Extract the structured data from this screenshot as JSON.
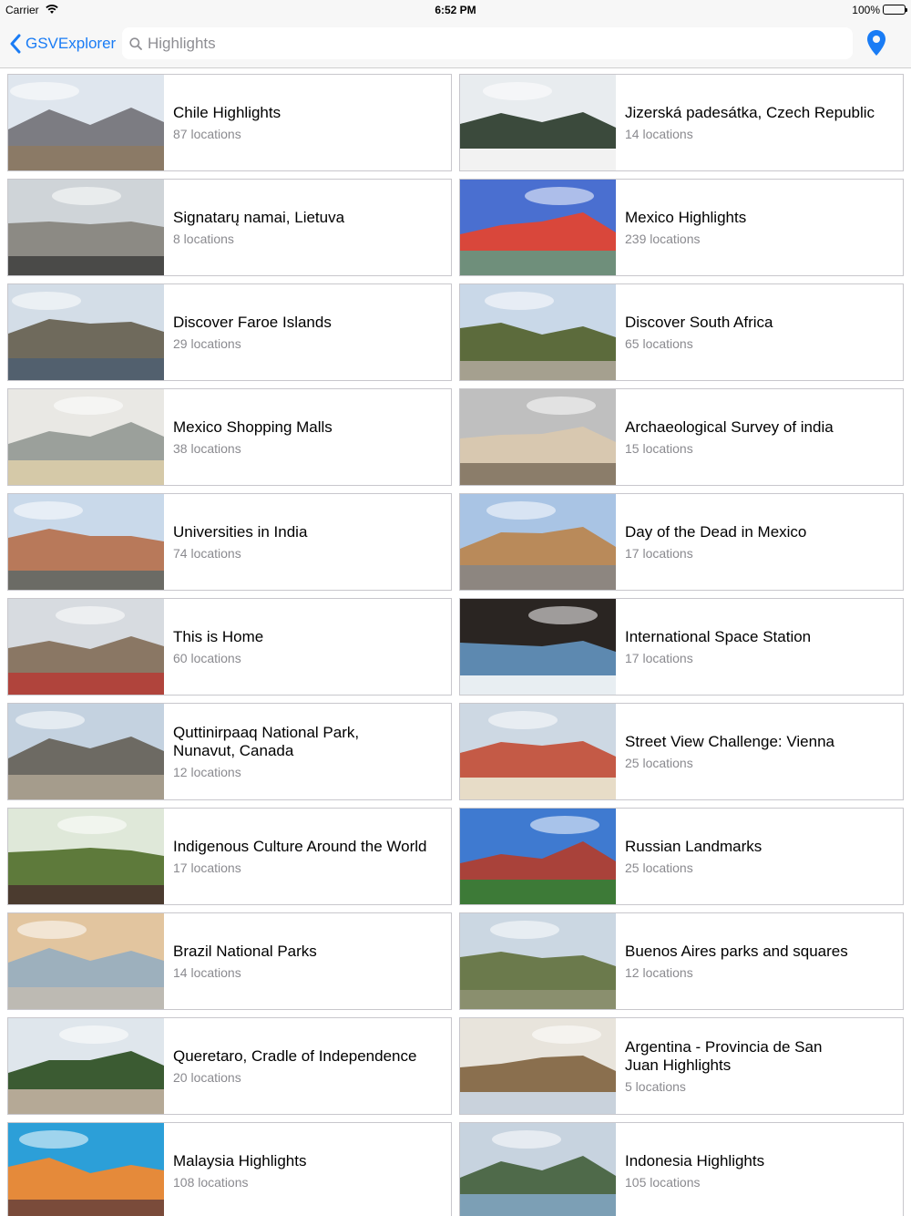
{
  "status_bar": {
    "carrier": "Carrier",
    "time": "6:52 PM",
    "battery": "100%"
  },
  "nav": {
    "back_label": "GSVExplorer",
    "search_placeholder": "Highlights",
    "search_value": "",
    "accent_color": "#1a7cf5"
  },
  "collections": [
    {
      "title": "Chile Highlights",
      "count": "87 locations",
      "thumb": [
        "#dfe6ee",
        "#7c7c82",
        "#8b7a66"
      ]
    },
    {
      "title": "Jizerská padesátka, Czech Republic",
      "count": "14 locations",
      "thumb": [
        "#e8ecef",
        "#3b4a3c",
        "#f2f2f2"
      ]
    },
    {
      "title": "Signatarų namai, Lietuva",
      "count": "8 locations",
      "thumb": [
        "#cfd4d8",
        "#8c8a84",
        "#4a4a48"
      ]
    },
    {
      "title": "Mexico Highlights",
      "count": "239 locations",
      "thumb": [
        "#4a6fd0",
        "#d9473b",
        "#6f8f7b"
      ]
    },
    {
      "title": "Discover Faroe Islands",
      "count": "29 locations",
      "thumb": [
        "#d3dde7",
        "#6f6a5c",
        "#52606e"
      ]
    },
    {
      "title": "Discover South Africa",
      "count": "65 locations",
      "thumb": [
        "#c9d8e8",
        "#5c6b3c",
        "#a5a08f"
      ]
    },
    {
      "title": "Mexico Shopping Malls",
      "count": "38 locations",
      "thumb": [
        "#e9e8e4",
        "#9ba09b",
        "#d5c9a8"
      ]
    },
    {
      "title": "Archaeological Survey of india",
      "count": "15 locations",
      "thumb": [
        "#bfbfbf",
        "#d8c8b0",
        "#8b7d6a"
      ]
    },
    {
      "title": "Universities in India",
      "count": "74 locations",
      "thumb": [
        "#c9d9ea",
        "#b8795a",
        "#6b6b65"
      ]
    },
    {
      "title": "Day of the Dead in Mexico",
      "count": "17 locations",
      "thumb": [
        "#a9c4e4",
        "#b98a5a",
        "#8d8680"
      ]
    },
    {
      "title": "This is Home",
      "count": "60 locations",
      "thumb": [
        "#d7dbe0",
        "#8a7764",
        "#b0443c"
      ]
    },
    {
      "title": "International Space Station",
      "count": "17 locations",
      "thumb": [
        "#2a2522",
        "#5d89b0",
        "#e8eef2"
      ]
    },
    {
      "title": "Quttinirpaaq National Park,\nNunavut, Canada",
      "count": "12 locations",
      "thumb": [
        "#c4d2e0",
        "#6d6a63",
        "#a59c8c"
      ]
    },
    {
      "title": "Street View Challenge: Vienna",
      "count": "25 locations",
      "thumb": [
        "#cdd8e3",
        "#c45a46",
        "#e7dcc7"
      ]
    },
    {
      "title": "Indigenous Culture Around the World",
      "count": "17 locations",
      "thumb": [
        "#dfe8d9",
        "#5e7a3b",
        "#4b3b2f"
      ]
    },
    {
      "title": "Russian Landmarks",
      "count": "25 locations",
      "thumb": [
        "#3f7ad0",
        "#a9423a",
        "#3d7a37"
      ]
    },
    {
      "title": "Brazil National Parks",
      "count": "14 locations",
      "thumb": [
        "#e2c59f",
        "#9db0bd",
        "#bdbab3"
      ]
    },
    {
      "title": "Buenos Aires parks and squares",
      "count": "12 locations",
      "thumb": [
        "#cbd7e2",
        "#6b7a4c",
        "#8a8f6e"
      ]
    },
    {
      "title": "Queretaro, Cradle of Independence",
      "count": "20 locations",
      "thumb": [
        "#dfe6ec",
        "#3b5b32",
        "#b5a996"
      ]
    },
    {
      "title": "Argentina - Provincia de San\nJuan  Highlights",
      "count": "5 locations",
      "thumb": [
        "#e8e4dc",
        "#8a6f4e",
        "#c9d2dc"
      ]
    },
    {
      "title": "Malaysia Highlights",
      "count": "108 locations",
      "thumb": [
        "#2c9fd8",
        "#e58a3a",
        "#7a4b3a"
      ]
    },
    {
      "title": "Indonesia Highlights",
      "count": "105 locations",
      "thumb": [
        "#c7d3df",
        "#4f6a4a",
        "#7c9fb5"
      ]
    }
  ]
}
